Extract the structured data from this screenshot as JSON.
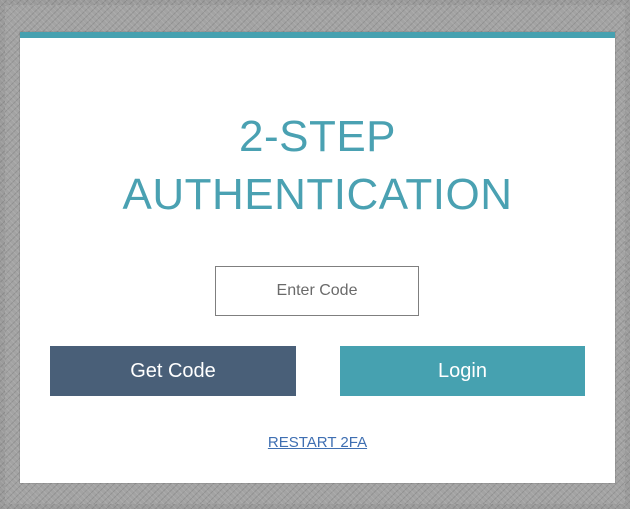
{
  "colors": {
    "accent": "#46a1b0",
    "title": "#4aa1b2",
    "get_code_button": "#495f78",
    "login_button": "#46a1b0",
    "link": "#3f6fb2",
    "card_bg": "#ffffff",
    "background": "#9b9b9b"
  },
  "auth": {
    "title_line1": "2-STEP",
    "title_line2": "AUTHENTICATION",
    "code_input": {
      "placeholder": "Enter Code",
      "value": ""
    },
    "buttons": {
      "get_code": "Get Code",
      "login": "Login"
    },
    "restart_link": "RESTART 2FA"
  }
}
